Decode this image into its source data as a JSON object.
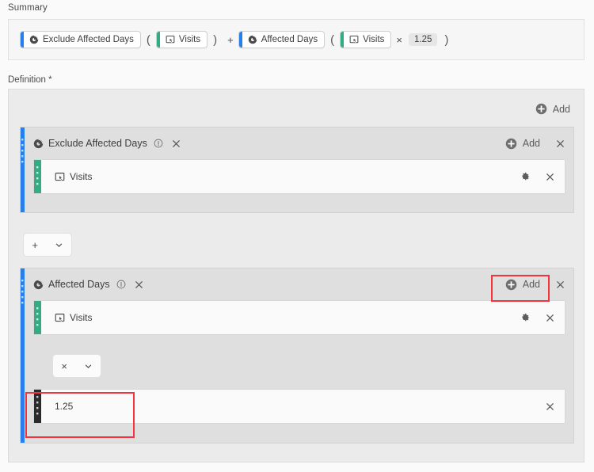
{
  "summary": {
    "label": "Summary",
    "expression": [
      {
        "kind": "chip",
        "type": "segment",
        "color": "#2680eb",
        "icon": "segment-icon",
        "text": "Exclude Affected Days"
      },
      {
        "kind": "paren",
        "text": "("
      },
      {
        "kind": "chip",
        "type": "metric",
        "color": "#33ab84",
        "icon": "metric-icon",
        "text": "Visits"
      },
      {
        "kind": "paren",
        "text": ")"
      },
      {
        "kind": "op",
        "text": "+"
      },
      {
        "kind": "chip",
        "type": "segment",
        "color": "#2680eb",
        "icon": "segment-icon",
        "text": "Affected Days"
      },
      {
        "kind": "paren",
        "text": "("
      },
      {
        "kind": "chip",
        "type": "metric",
        "color": "#33ab84",
        "icon": "metric-icon",
        "text": "Visits"
      },
      {
        "kind": "op",
        "text": "×"
      },
      {
        "kind": "number",
        "text": "1.25"
      },
      {
        "kind": "paren",
        "text": ")"
      }
    ]
  },
  "definition": {
    "label": "Definition *",
    "top_add": {
      "label": "Add",
      "icon": "add-circle-icon"
    },
    "containers": [
      {
        "title": "Exclude Affected Days",
        "icon": "segment-icon",
        "info_icon": "info-icon",
        "close_icon": "close-icon",
        "add": {
          "label": "Add",
          "icon": "add-circle-icon"
        },
        "rail_color": "#2680eb",
        "rows": [
          {
            "type": "metric",
            "label": "Visits",
            "icon": "metric-icon",
            "rail_color": "#33ab84",
            "has_settings": true,
            "settings_icon": "gear-icon",
            "close_icon": "close-icon"
          }
        ]
      },
      {
        "title": "Affected Days",
        "icon": "segment-icon",
        "info_icon": "info-icon",
        "close_icon": "close-icon",
        "add": {
          "label": "Add",
          "icon": "add-circle-icon"
        },
        "rail_color": "#2680eb",
        "rows": [
          {
            "type": "metric",
            "label": "Visits",
            "icon": "metric-icon",
            "rail_color": "#33ab84",
            "has_settings": true,
            "settings_icon": "gear-icon",
            "close_icon": "close-icon"
          },
          {
            "type": "static",
            "label": "1.25",
            "rail_color": "#2b2b2b",
            "has_settings": false,
            "close_icon": "close-icon"
          }
        ]
      }
    ],
    "operators": [
      {
        "symbol": "+",
        "chevron": "chevron-down-icon"
      },
      {
        "symbol": "×",
        "chevron": "chevron-down-icon"
      }
    ]
  },
  "highlights": {
    "color": "#f5333f",
    "items": [
      {
        "name": "highlight-add-button-affected-days"
      },
      {
        "name": "highlight-static-value-1-25"
      }
    ]
  }
}
